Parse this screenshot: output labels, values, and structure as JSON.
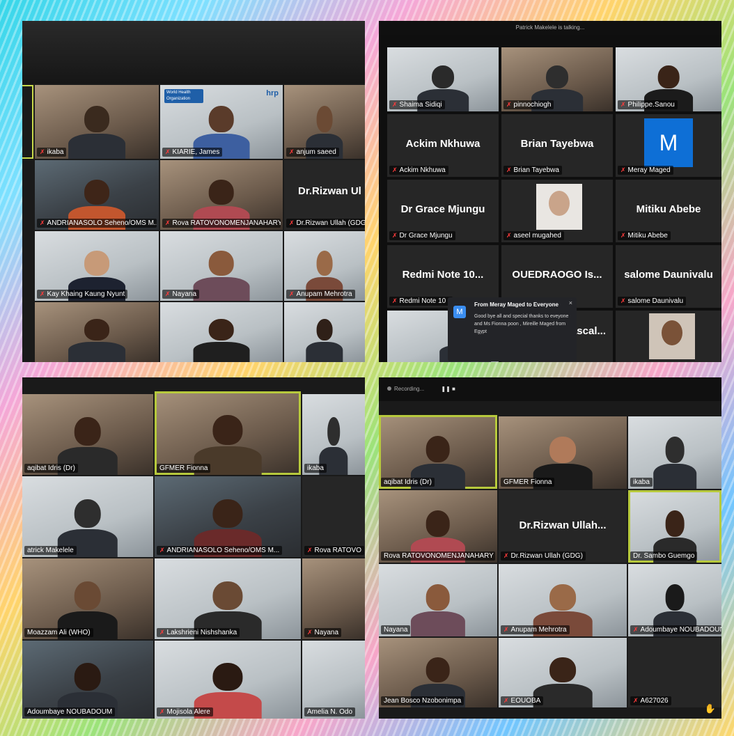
{
  "panel_tl": {
    "tiles": [
      {
        "name": "ikaba"
      },
      {
        "name": "KIARIE, James"
      },
      {
        "name": "anjum saeed"
      },
      {
        "name": "ANDRIANASOLO Seheno/OMS M..."
      },
      {
        "name": "Rova RATOVONOMENJANAHARY"
      },
      {
        "name": "Dr.Rizwan Ullah (GDG)",
        "big": "Dr.Rizwan Ul"
      },
      {
        "name": "Kay Khaing Kaung Nyunt"
      },
      {
        "name": "Nayana"
      },
      {
        "name": "Anupam Mehrotra"
      }
    ],
    "who_logo": "World Health Organization",
    "hrp_logo": "hrp"
  },
  "panel_tr": {
    "talking": "Patrick Makelele is talking...",
    "tiles": [
      {
        "name": "Shaima Sidiqi"
      },
      {
        "name": "pinnochiogh"
      },
      {
        "name": "Philippe.Sanou"
      },
      {
        "name": "Ackim Nkhuwa",
        "big": "Ackim Nkhuwa"
      },
      {
        "name": "Brian Tayebwa",
        "big": "Brian Tayebwa"
      },
      {
        "name": "Meray Maged",
        "avatar": "M"
      },
      {
        "name": "Dr Grace Mjungu",
        "big": "Dr Grace Mjungu"
      },
      {
        "name": "aseel mugahed"
      },
      {
        "name": "Mitiku Abebe",
        "big": "Mitiku Abebe"
      },
      {
        "name": "Redmi Note 10 I",
        "big": "Redmi Note 10..."
      },
      {
        "big": "OUEDRAOGO Is..."
      },
      {
        "name": "salome Daunivalu",
        "big": "salome Daunivalu"
      },
      {
        "big": "ascal..."
      }
    ],
    "chat": {
      "avatar": "M",
      "title": "From Meray Maged to Everyone",
      "message": "Good bye all and special thanks to eveyone  and Ms Fionna poon , Mireille Maged from Egypt",
      "close": "×"
    }
  },
  "panel_bl": {
    "tiles": [
      {
        "name": "aqibat Idris (Dr)"
      },
      {
        "name": "GFMER Fionna"
      },
      {
        "name": "ikaba"
      },
      {
        "name": "atrick Makelele"
      },
      {
        "name": "ANDRIANASOLO Seheno/OMS M..."
      },
      {
        "name": "Rova RATOVO"
      },
      {
        "name": "Moazzam Ali (WHO)"
      },
      {
        "name": "Lakshrieni Nishshanka"
      },
      {
        "name": "Nayana"
      },
      {
        "name": "Adoumbaye NOUBADOUM"
      },
      {
        "name": "Mojisola Alere"
      },
      {
        "name": "Amelia N. Odo"
      }
    ]
  },
  "panel_br": {
    "recording": "Recording...",
    "controls": "❚❚  ■",
    "tiles": [
      {
        "name": "aqibat Idris (Dr)"
      },
      {
        "name": "GFMER Fionna"
      },
      {
        "name": "ikaba"
      },
      {
        "name": "Rova RATOVONOMENJANAHARY"
      },
      {
        "name": "Dr.Rizwan Ullah (GDG)",
        "big": "Dr.Rizwan  Ullah..."
      },
      {
        "name": "Dr. Sambo Guemgo"
      },
      {
        "name": "Nayana"
      },
      {
        "name": "Anupam Mehrotra"
      },
      {
        "name": "Adoumbaye NOUBADOUN"
      },
      {
        "name": "Jean Bosco Nzobonimpa"
      },
      {
        "name": "EOUOBA"
      },
      {
        "name": "A627026"
      }
    ],
    "hand_icon": "✋"
  }
}
